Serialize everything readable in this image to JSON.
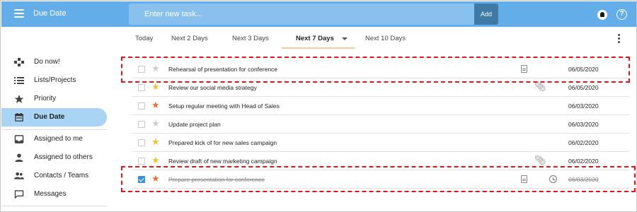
{
  "app": {
    "title": "Due Date"
  },
  "header": {
    "task_input_placeholder": "Enter new task...",
    "add_label": "Add"
  },
  "tabs": [
    {
      "label": "Today"
    },
    {
      "label": "Next 2 Days"
    },
    {
      "label": "Next 3 Days"
    },
    {
      "label": "Next 7 Days",
      "active": true
    },
    {
      "label": "Next 10 Days"
    }
  ],
  "sidebar": {
    "items": [
      {
        "label": "Do now!",
        "icon": "gamepad-icon"
      },
      {
        "label": "Lists/Projects",
        "icon": "list-icon"
      },
      {
        "label": "Priority",
        "icon": "star-icon"
      },
      {
        "label": "Due Date",
        "icon": "calendar-icon",
        "active": true
      },
      {
        "label": "Assigned to me",
        "icon": "inbox-icon"
      },
      {
        "label": "Assigned to others",
        "icon": "person-icon"
      },
      {
        "label": "Contacts / Teams",
        "icon": "people-icon"
      },
      {
        "label": "Messages",
        "icon": "chat-icon"
      }
    ]
  },
  "tasks": [
    {
      "title": "Rehearsal of presentation for conference",
      "date": "06/05/2020",
      "star_color": "#cccccc",
      "checked": false,
      "icons": [
        "note-icon"
      ]
    },
    {
      "title": "Review our social media strategy",
      "date": "06/05/2020",
      "star_color": "#f2c230",
      "checked": false,
      "icons": [
        "paperclip-icon"
      ]
    },
    {
      "title": "Setup regular meeting with Head of Sales",
      "date": "06/03/2020",
      "star_color": "#e8733a",
      "checked": false,
      "icons": []
    },
    {
      "title": "Update project plan",
      "date": "06/03/2020",
      "star_color": "#cccccc",
      "checked": false,
      "icons": []
    },
    {
      "title": "Prepared kick of for new sales campaign",
      "date": "06/02/2020",
      "star_color": "#f2c230",
      "checked": false,
      "icons": []
    },
    {
      "title": "Review draft of new marketing campaign",
      "date": "06/02/2020",
      "star_color": "#f2c230",
      "checked": false,
      "icons": [
        "paperclip-icon"
      ]
    },
    {
      "title": "Prepare presentation for conference",
      "date": "06/03/2020",
      "star_color": "#e8733a",
      "checked": true,
      "icons": [
        "note-icon",
        "alarm-icon"
      ]
    }
  ],
  "colors": {
    "topbar": "#63aee8",
    "accent_active": "#a9d4f4",
    "highlight": "#e0141a",
    "star_orange": "#e8733a",
    "star_yellow": "#f2c230",
    "star_grey": "#cccccc"
  }
}
